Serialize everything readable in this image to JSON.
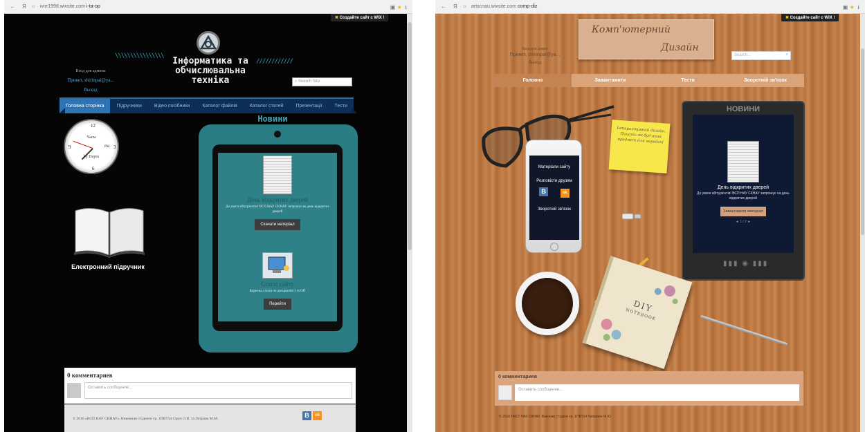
{
  "left": {
    "browser": {
      "url_host": "ivirr1998.wixsite.com",
      "url_path": "i-ta-op"
    },
    "wix_banner": "Создайте сайт с WIX !",
    "site_title": "Інформатика та обчислювальна техніка",
    "login": {
      "label": "Вход для админа",
      "greeting": "Привет, shirinpai@ya...",
      "logout": "Выход"
    },
    "search_placeholder": "Search Site",
    "nav": [
      "Головна сторінка",
      "Підручники",
      "Відео посібники",
      "Каталог файлів",
      "Каталог статей",
      "Презентації",
      "Тести"
    ],
    "clock": {
      "brand": "Часы",
      "by": "by Dayes",
      "pm": "PM",
      "numbers": [
        "12",
        "3",
        "6",
        "9"
      ]
    },
    "book_label": "Електронний підручник",
    "news_title": "Новини",
    "news": [
      {
        "title": "День відкритих дверей",
        "text": "До уваги абітурієнтів! ВСП НАУ СКНАУ запрошує на день відкритих дверей",
        "button": "Скачати матеріал"
      },
      {
        "title": "Статті сайту",
        "text": "Корисна стаття по дисципліні I та ОП",
        "button": "Перейти"
      }
    ],
    "comments": {
      "count_label": "0 комментариев",
      "placeholder": "Оставить сообщение..."
    },
    "footer": "© 2016 «ВСП НАУ СКНАУ». Виконали студенти гр. 1ПВТ14 Сірук О.В. та Лєтрова М.М.",
    "social": {
      "vk": "B",
      "ok": "ok"
    }
  },
  "right": {
    "browser": {
      "url_host": "artscnau.wixsite.com",
      "url_path": "comp-diz"
    },
    "wix_banner": "Создайте сайт с WIX !",
    "title_line1": "Комп'ютерний",
    "title_line2": "Дизайн",
    "login": {
      "label": "Вход для админ",
      "greeting": "Привет, shirinpai@ya...",
      "logout": "Выход"
    },
    "search_placeholder": "Search...",
    "nav": [
      "Головна",
      "Завантажити",
      "Тести",
      "Зворотній зв'язок"
    ],
    "phone": {
      "item1": "Матеріали сайту",
      "item2": "Розповісти друзям",
      "item3": "Зворотній зв'язок",
      "vk": "B",
      "ok": "ok"
    },
    "sticky_note": "Інтерактивний дизайн. Пишіть як буд який предмет для передачі",
    "ebook": {
      "title": "НОВИНИ",
      "news_title": "День відкритих дверей",
      "news_text": "До уваги абітурієнтів! ВСП НАУ СКНАУ запрошує на день відкритих дверей",
      "button": "Завантажити матеріал",
      "pager": "◄ 1 / 2 ►"
    },
    "notebook": {
      "title": "DIY",
      "subtitle": "NOTEBOOK"
    },
    "comments": {
      "count_label": "0 комментариев",
      "placeholder": "Оставить сообщение..."
    },
    "footer": "© 2016 НКСТ НАУ СКНАУ. Виконав студент гр. 1ПВТ14 Чупринін Ж.Ю."
  }
}
